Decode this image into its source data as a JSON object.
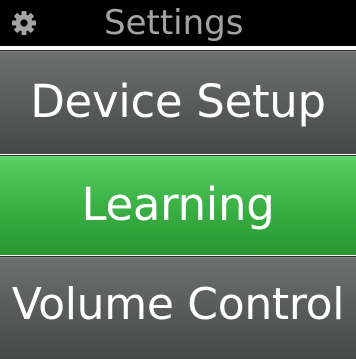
{
  "header": {
    "icon": "gear-icon",
    "title": "Settings"
  },
  "menu": {
    "items": [
      {
        "label": "Device Setup",
        "selected": false
      },
      {
        "label": "Learning",
        "selected": true
      },
      {
        "label": "Volume Control",
        "selected": false
      }
    ]
  },
  "colors": {
    "header_background": "#000000",
    "header_text": "#a3a3a3",
    "item_background": "#5b5e5d",
    "selected_background": "#3fb74a",
    "item_text": "#ffffff"
  }
}
